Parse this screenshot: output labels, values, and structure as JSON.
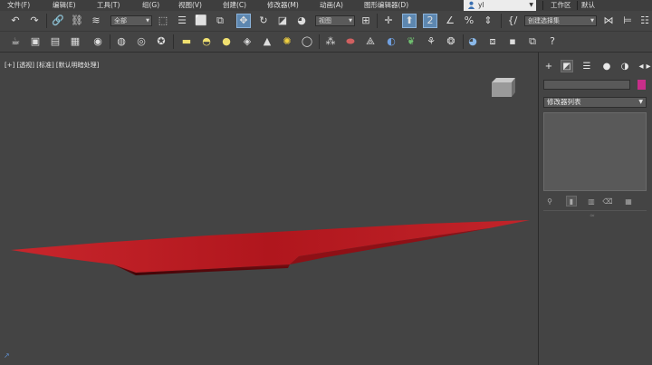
{
  "menu": {
    "items": [
      "文件(F)",
      "编辑(E)",
      "工具(T)",
      "组(G)",
      "视图(V)",
      "创建(C)",
      "修改器(M)",
      "动画(A)",
      "图形编辑器(D)"
    ],
    "user": "yl",
    "workspace_label": "工作区",
    "workspace_value": "默认"
  },
  "toolbar1": {
    "selection_filter": "全部",
    "ref_coord": "视图",
    "named_selection": "创建选择集"
  },
  "viewport": {
    "label": "[+] [透视] [标准] [默认明暗处理]",
    "object_color": "#b01a22"
  },
  "command_panel": {
    "modifier_list": "修改器列表",
    "object_color": "#c82e8a"
  },
  "colors": {
    "background": "#444444",
    "active_button": "#5d87b0"
  }
}
